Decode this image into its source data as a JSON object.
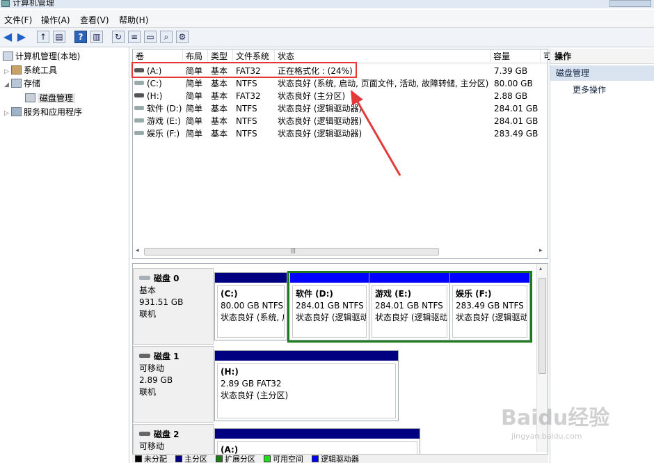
{
  "window": {
    "title": "计算机管理"
  },
  "menu": [
    "文件(F)",
    "操作(A)",
    "查看(V)",
    "帮助(H)"
  ],
  "tree": {
    "root": "计算机管理(本地)",
    "system_tools": "系统工具",
    "storage": "存储",
    "disk_management": "磁盘管理",
    "services": "服务和应用程序"
  },
  "columns": [
    "卷",
    "布局",
    "类型",
    "文件系统",
    "状态",
    "容量",
    "可"
  ],
  "volumes": [
    {
      "name": "(A:)",
      "layout": "简单",
      "type": "基本",
      "fs": "FAT32",
      "status": "正在格式化 : (24%)",
      "capacity": "7.39 GB"
    },
    {
      "name": "(C:)",
      "layout": "简单",
      "type": "基本",
      "fs": "NTFS",
      "status": "状态良好 (系统, 启动, 页面文件, 活动, 故障转储, 主分区)",
      "capacity": "80.00 GB"
    },
    {
      "name": "(H:)",
      "layout": "简单",
      "type": "基本",
      "fs": "FAT32",
      "status": "状态良好 (主分区)",
      "capacity": "2.88 GB"
    },
    {
      "name": "软件 (D:)",
      "layout": "简单",
      "type": "基本",
      "fs": "NTFS",
      "status": "状态良好 (逻辑驱动器)",
      "capacity": "284.01 GB"
    },
    {
      "name": "游戏 (E:)",
      "layout": "简单",
      "type": "基本",
      "fs": "NTFS",
      "status": "状态良好 (逻辑驱动器)",
      "capacity": "284.01 GB"
    },
    {
      "name": "娱乐 (F:)",
      "layout": "简单",
      "type": "基本",
      "fs": "NTFS",
      "status": "状态良好 (逻辑驱动器)",
      "capacity": "283.49 GB"
    }
  ],
  "disks": [
    {
      "name": "磁盘 0",
      "kind": "基本",
      "size": "931.51 GB",
      "state": "联机",
      "partitions": [
        {
          "label": "(C:)",
          "size": "80.00 GB NTFS",
          "status": "状态良好 (系统, 启"
        },
        {
          "label": "软件  (D:)",
          "size": "284.01 GB NTFS",
          "status": "状态良好 (逻辑驱动"
        },
        {
          "label": "游戏  (E:)",
          "size": "284.01 GB NTFS",
          "status": "状态良好 (逻辑驱动"
        },
        {
          "label": "娱乐  (F:)",
          "size": "283.49 GB NTFS",
          "status": "状态良好 (逻辑驱动"
        }
      ]
    },
    {
      "name": "磁盘 1",
      "kind": "可移动",
      "size": "2.89 GB",
      "state": "联机",
      "partitions": [
        {
          "label": "(H:)",
          "size": "2.89 GB FAT32",
          "status": "状态良好 (主分区)"
        }
      ]
    },
    {
      "name": "磁盘 2",
      "kind": "可移动",
      "size": "",
      "state": "",
      "partitions": [
        {
          "label": "(A:)",
          "size": "",
          "status": ""
        }
      ]
    }
  ],
  "legend": [
    "未分配",
    "主分区",
    "扩展分区",
    "可用空间",
    "逻辑驱动器"
  ],
  "colors": {
    "primary": "#000080",
    "logical": "#0000ff",
    "extended": "#1f7a1f",
    "free": "#22dd22",
    "unallocated": "#000000",
    "highlight_red": "#e23a3a"
  },
  "actions": {
    "header": "操作",
    "section": "磁盘管理",
    "more": "更多操作"
  },
  "watermark": {
    "logo": "Baidu经验",
    "url": "jingyan.baidu.com"
  }
}
